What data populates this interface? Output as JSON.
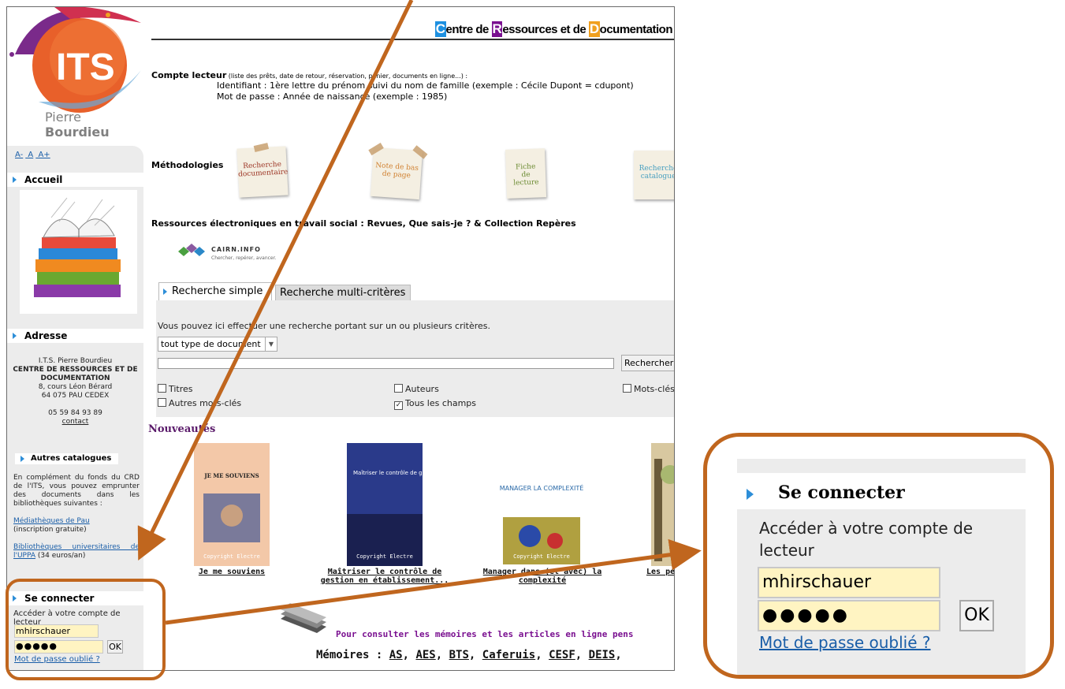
{
  "header": {
    "crd_title_parts": [
      "C",
      "entre de ",
      "R",
      "essources et de ",
      "D",
      "ocumentation"
    ],
    "cap_colors": [
      "#1e90e0",
      "#7a1090",
      "#f0a020"
    ],
    "logo_text": "ITS",
    "logo_sub_light": "Pierre ",
    "logo_sub_bold": "Bourdieu"
  },
  "sidebar": {
    "font_sizes": [
      "A-",
      "A",
      "A+"
    ],
    "accueil": "Accueil",
    "adresse": "Adresse",
    "address_lines": [
      "I.T.S. Pierre Bourdieu",
      "CENTRE DE RESSOURCES ET DE DOCUMENTATION",
      "8, cours Léon Bérard",
      "64 075 PAU CEDEX"
    ],
    "phone": "05 59 84 93 89",
    "contact": "contact",
    "autres_catalogues": "Autres catalogues",
    "catalogues_intro": "En complément du fonds du CRD de l'ITS, vous pouvez emprunter des documents dans les bibliothèques suivantes :",
    "link1": "Médiathèques de Pau",
    "link1_note": "(inscription gratuite)",
    "link2": "Bibliothèques universitaires de l'UPPA",
    "link2_note": "(34 euros/an)",
    "login": {
      "title": "Se connecter",
      "desc": "Accéder à votre compte de lecteur",
      "username": "mhirschauer",
      "password_mask": "●●●●●",
      "ok": "OK",
      "forgot": "Mot de passe oublié ?"
    }
  },
  "main": {
    "compte_label": "Compte lecteur",
    "compte_small": " (liste des prêts, date de retour, réservation, panier, documents en ligne...) :",
    "id_line": "Identifiant :  1ère lettre du prénom suivi du nom de famille (exemple : Cécile Dupont = cdupont)",
    "pwd_line": "Mot de passe : Année de naissance (exemple : 1985)",
    "methodologies": "Méthodologies",
    "notes": [
      "Recherche documentaire",
      "Note de bas de page",
      "Fiche de lecture",
      "Recherche catalogue"
    ],
    "note_colors": [
      "#9a3020",
      "#d08030",
      "#6a8a30",
      "#4aa0c0"
    ],
    "ressources": "Ressources électroniques en travail social : Revues, Que sais-je ? & Collection Repères",
    "cairn_name": "CAIRN.INFO",
    "cairn_sub": "Chercher, repérer, avancer."
  },
  "search": {
    "tab_simple": "Recherche simple",
    "tab_multi": "Recherche multi-critères",
    "hint": "Vous pouvez ici effectuer une recherche portant sur un ou plusieurs critères.",
    "doc_type": "tout type de document",
    "button": "Rechercher",
    "checkboxes": [
      {
        "label": "Titres",
        "checked": false
      },
      {
        "label": "Auteurs",
        "checked": false
      },
      {
        "label": "Mots-clés",
        "checked": false
      },
      {
        "label": "Autres mots-clés",
        "checked": false
      },
      {
        "label": "Tous les champs",
        "checked": true
      }
    ]
  },
  "nouveautes": {
    "title": "Nouveautés",
    "books": [
      {
        "title": "Je me souviens",
        "cover_text": "JE ME SOUVIENS"
      },
      {
        "title": "Maîtriser le contrôle de gestion en établissement...",
        "cover_text": "Maîtriser le contrôle de gestion"
      },
      {
        "title": "Manager dans (et avec) la complexité",
        "cover_text": "MANAGER LA COMPLEXITÉ"
      },
      {
        "title": "Les pet",
        "cover_text": ""
      }
    ],
    "copyright": "Copyright Electre"
  },
  "memoires": {
    "pour": "Pour consulter les mémoires et les articles en ligne pens",
    "label": "Mémoires",
    "links": [
      "AS",
      "AES",
      "BTS",
      "Caferuis",
      "CESF",
      "DEIS"
    ]
  },
  "zoom": {
    "title": "Se connecter",
    "desc": "Accéder à votre compte de lecteur",
    "username": "mhirschauer",
    "password_mask": "●●●●●",
    "ok": "OK",
    "forgot": "Mot de passe oublié ?"
  },
  "annotation_color": "#c0661e"
}
